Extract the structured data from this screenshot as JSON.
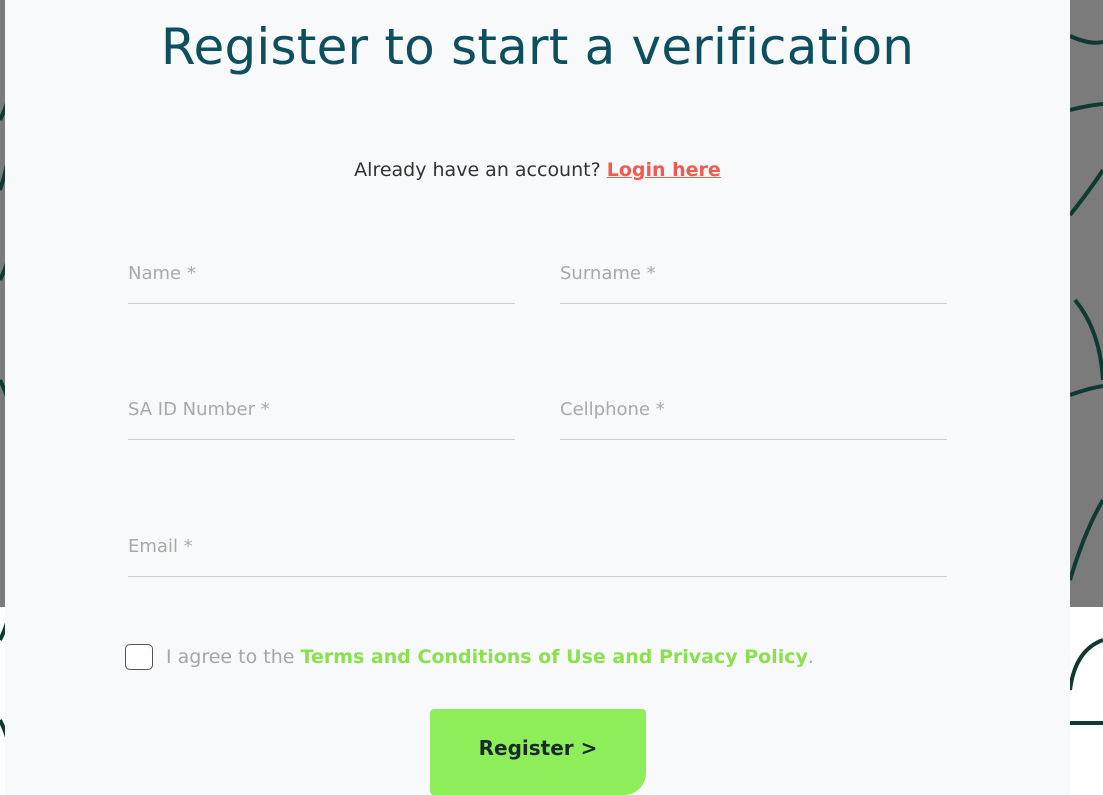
{
  "page": {
    "title": "Register to start a verification"
  },
  "login": {
    "prompt": "Already have an account?",
    "link_label": "Login here"
  },
  "form": {
    "name_placeholder": "Name *",
    "surname_placeholder": "Surname *",
    "id_placeholder": "SA ID Number *",
    "cellphone_placeholder": "Cellphone *",
    "email_placeholder": "Email *",
    "name_value": "",
    "surname_value": "",
    "id_value": "",
    "cellphone_value": "",
    "email_value": ""
  },
  "terms": {
    "checked": false,
    "prefix": "I agree to the",
    "link_label": "Terms and Conditions of Use and Privacy Policy",
    "suffix": "."
  },
  "actions": {
    "register_label": "Register >"
  },
  "colors": {
    "title": "#0d4f5e",
    "login_link": "#f05a4f",
    "terms_link": "#8be04e",
    "register_button": "#8eee5a",
    "overlay": "#7b7b7b",
    "arc_lines": "#0f3a34"
  }
}
